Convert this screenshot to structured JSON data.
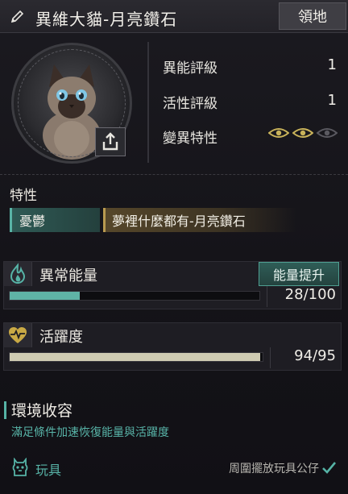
{
  "header": {
    "title": "異維大貓-月亮鑽石",
    "territory_button": "領地"
  },
  "stats": {
    "ability_label": "異能評級",
    "ability_value": "1",
    "activity_label": "活性評級",
    "activity_value": "1",
    "mutation_label": "變異特性",
    "mutation_eyes_active": 2,
    "mutation_eyes_total": 3
  },
  "traits": {
    "section_title": "特性",
    "items": [
      "憂鬱",
      "夢裡什麼都有-月亮鑽石"
    ]
  },
  "energy": {
    "label": "異常能量",
    "boost_button": "能量提升",
    "value_text": "28/100",
    "current": 28,
    "max": 100,
    "bar_color": "#5fb3a6"
  },
  "activity": {
    "label": "活躍度",
    "value_text": "94/95",
    "current": 94,
    "max": 95,
    "bar_color": "#cfcbb2"
  },
  "environment": {
    "title": "環境收容",
    "description": "滿足條件加速恢復能量與活躍度",
    "toy_label": "玩具",
    "toy_condition": "周圍擺放玩具公仔"
  },
  "colors": {
    "accent_teal": "#56b3a6",
    "gold": "#c9b35a"
  },
  "icons": {
    "edit": "pencil-icon",
    "share": "share-icon",
    "mutation": "eye-icon",
    "energy": "flame-icon",
    "activity": "heart-pulse-icon",
    "toy": "toy-icon",
    "check": "check-icon"
  }
}
